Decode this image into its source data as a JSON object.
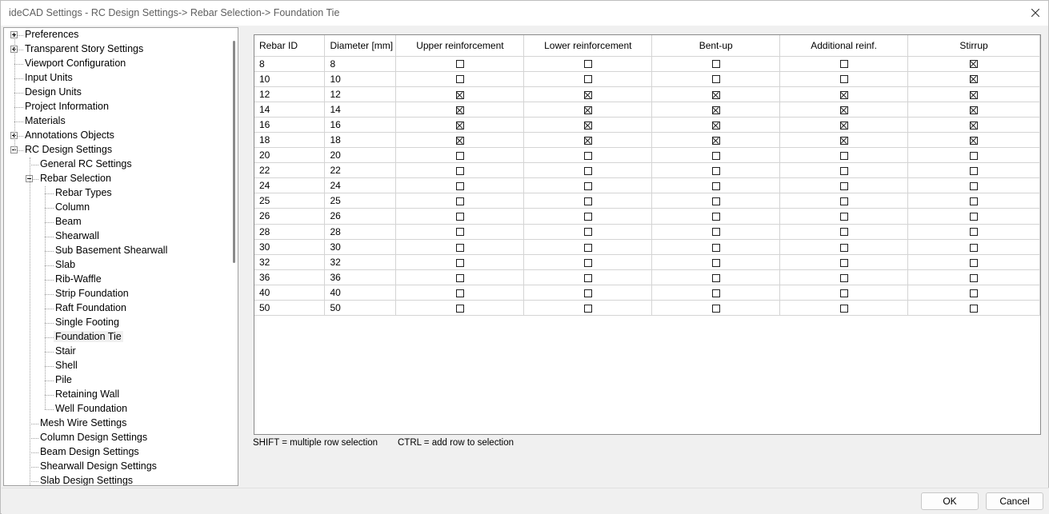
{
  "window": {
    "title": "ideCAD Settings - RC Design Settings-> Rebar Selection-> Foundation Tie"
  },
  "tree": {
    "items": [
      {
        "label": "Preferences",
        "level": 0,
        "expander": "plus"
      },
      {
        "label": "Transparent Story Settings",
        "level": 0,
        "expander": "plus"
      },
      {
        "label": "Viewport Configuration",
        "level": 0,
        "expander": ""
      },
      {
        "label": "Input Units",
        "level": 0,
        "expander": ""
      },
      {
        "label": "Design Units",
        "level": 0,
        "expander": ""
      },
      {
        "label": "Project Information",
        "level": 0,
        "expander": ""
      },
      {
        "label": "Materials",
        "level": 0,
        "expander": ""
      },
      {
        "label": "Annotations Objects",
        "level": 0,
        "expander": "plus"
      },
      {
        "label": "RC Design Settings",
        "level": 0,
        "expander": "minus"
      },
      {
        "label": "General RC Settings",
        "level": 1,
        "expander": ""
      },
      {
        "label": "Rebar Selection",
        "level": 1,
        "expander": "minus"
      },
      {
        "label": "Rebar Types",
        "level": 2,
        "expander": ""
      },
      {
        "label": "Column",
        "level": 2,
        "expander": ""
      },
      {
        "label": "Beam",
        "level": 2,
        "expander": ""
      },
      {
        "label": "Shearwall",
        "level": 2,
        "expander": ""
      },
      {
        "label": "Sub Basement Shearwall",
        "level": 2,
        "expander": ""
      },
      {
        "label": "Slab",
        "level": 2,
        "expander": ""
      },
      {
        "label": "Rib-Waffle",
        "level": 2,
        "expander": ""
      },
      {
        "label": "Strip Foundation",
        "level": 2,
        "expander": ""
      },
      {
        "label": "Raft Foundation",
        "level": 2,
        "expander": ""
      },
      {
        "label": "Single Footing",
        "level": 2,
        "expander": ""
      },
      {
        "label": "Foundation Tie",
        "level": 2,
        "expander": "",
        "selected": true
      },
      {
        "label": "Stair",
        "level": 2,
        "expander": ""
      },
      {
        "label": "Shell",
        "level": 2,
        "expander": ""
      },
      {
        "label": "Pile",
        "level": 2,
        "expander": ""
      },
      {
        "label": "Retaining Wall",
        "level": 2,
        "expander": ""
      },
      {
        "label": "Well Foundation",
        "level": 2,
        "expander": ""
      },
      {
        "label": "Mesh Wire Settings",
        "level": 1,
        "expander": ""
      },
      {
        "label": "Column Design Settings",
        "level": 1,
        "expander": ""
      },
      {
        "label": "Beam Design Settings",
        "level": 1,
        "expander": ""
      },
      {
        "label": "Shearwall Design Settings",
        "level": 1,
        "expander": ""
      },
      {
        "label": "Slab Design Settings",
        "level": 1,
        "expander": ""
      }
    ]
  },
  "grid": {
    "columns": [
      "Rebar ID",
      "Diameter [mm]",
      "Upper reinforcement",
      "Lower reinforcement",
      "Bent-up",
      "Additional reinf.",
      "Stirrup"
    ],
    "rows": [
      {
        "id": "8",
        "diameter": "8",
        "checks": [
          false,
          false,
          false,
          false,
          true
        ]
      },
      {
        "id": "10",
        "diameter": "10",
        "checks": [
          false,
          false,
          false,
          false,
          true
        ]
      },
      {
        "id": "12",
        "diameter": "12",
        "checks": [
          true,
          true,
          true,
          true,
          true
        ]
      },
      {
        "id": "14",
        "diameter": "14",
        "checks": [
          true,
          true,
          true,
          true,
          true
        ]
      },
      {
        "id": "16",
        "diameter": "16",
        "checks": [
          true,
          true,
          true,
          true,
          true
        ]
      },
      {
        "id": "18",
        "diameter": "18",
        "checks": [
          true,
          true,
          true,
          true,
          true
        ]
      },
      {
        "id": "20",
        "diameter": "20",
        "checks": [
          false,
          false,
          false,
          false,
          false
        ]
      },
      {
        "id": "22",
        "diameter": "22",
        "checks": [
          false,
          false,
          false,
          false,
          false
        ]
      },
      {
        "id": "24",
        "diameter": "24",
        "checks": [
          false,
          false,
          false,
          false,
          false
        ]
      },
      {
        "id": "25",
        "diameter": "25",
        "checks": [
          false,
          false,
          false,
          false,
          false
        ]
      },
      {
        "id": "26",
        "diameter": "26",
        "checks": [
          false,
          false,
          false,
          false,
          false
        ]
      },
      {
        "id": "28",
        "diameter": "28",
        "checks": [
          false,
          false,
          false,
          false,
          false
        ]
      },
      {
        "id": "30",
        "diameter": "30",
        "checks": [
          false,
          false,
          false,
          false,
          false
        ]
      },
      {
        "id": "32",
        "diameter": "32",
        "checks": [
          false,
          false,
          false,
          false,
          false
        ]
      },
      {
        "id": "36",
        "diameter": "36",
        "checks": [
          false,
          false,
          false,
          false,
          false
        ]
      },
      {
        "id": "40",
        "diameter": "40",
        "checks": [
          false,
          false,
          false,
          false,
          false
        ]
      },
      {
        "id": "50",
        "diameter": "50",
        "checks": [
          false,
          false,
          false,
          false,
          false
        ]
      }
    ]
  },
  "hints": {
    "shift": "SHIFT = multiple row selection",
    "ctrl": "CTRL = add row to selection"
  },
  "buttons": {
    "ok": "OK",
    "cancel": "Cancel"
  }
}
